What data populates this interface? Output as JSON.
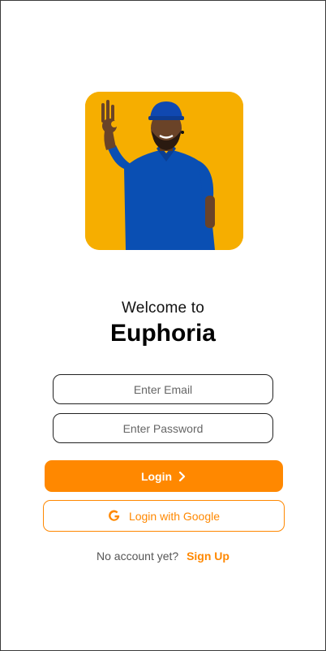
{
  "welcome": {
    "greeting": "Welcome to",
    "app_name": "Euphoria"
  },
  "form": {
    "email_placeholder": "Enter Email",
    "password_placeholder": "Enter Password",
    "email_value": "",
    "password_value": ""
  },
  "buttons": {
    "login_label": "Login",
    "login_icon": "chevron-right-icon",
    "google_label": "Login with Google",
    "google_icon": "google-icon"
  },
  "signup": {
    "prompt": "No account yet?",
    "link_label": "Sign Up"
  },
  "colors": {
    "accent": "#ff8800",
    "hero_background": "#f6ae00",
    "shirt": "#0a4fb3"
  }
}
